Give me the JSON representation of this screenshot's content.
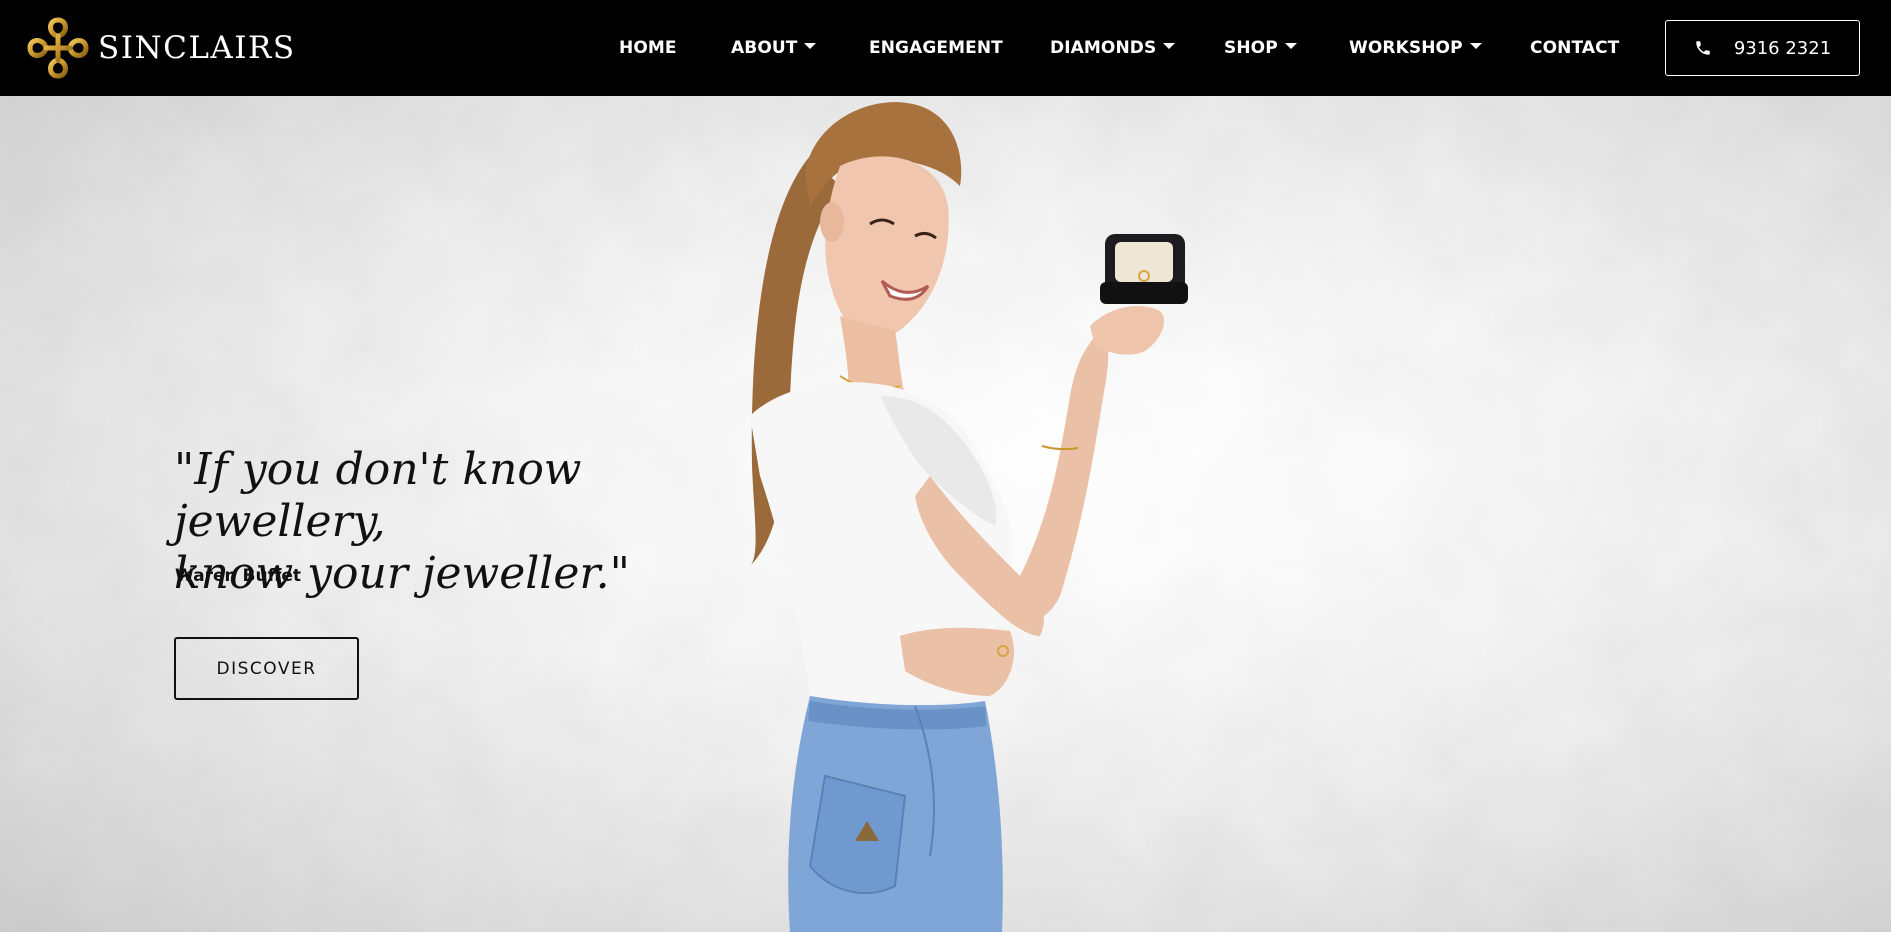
{
  "brand": {
    "name": "SINCLAIRS",
    "logo_icon": "celtic-knot-logo",
    "accent": "#c9962e"
  },
  "nav": {
    "items": [
      {
        "label": "HOME",
        "dropdown": false
      },
      {
        "label": "ABOUT",
        "dropdown": true
      },
      {
        "label": "ENGAGEMENT",
        "dropdown": false
      },
      {
        "label": "DIAMONDS",
        "dropdown": true
      },
      {
        "label": "SHOP",
        "dropdown": true
      },
      {
        "label": "WORKSHOP",
        "dropdown": true
      },
      {
        "label": "CONTACT",
        "dropdown": false
      }
    ],
    "phone": {
      "icon": "phone-icon",
      "label": "9316 2321"
    }
  },
  "hero": {
    "quote_line1": "\"If you don't know jewellery,",
    "quote_line2": "know your jeweller.\"",
    "author": "Waren Buffet",
    "cta_label": "DISCOVER",
    "image": "woman-holding-ring-box"
  },
  "colors": {
    "header_bg": "#000000",
    "text_dark": "#111111",
    "denim": "#7fa6d6"
  }
}
